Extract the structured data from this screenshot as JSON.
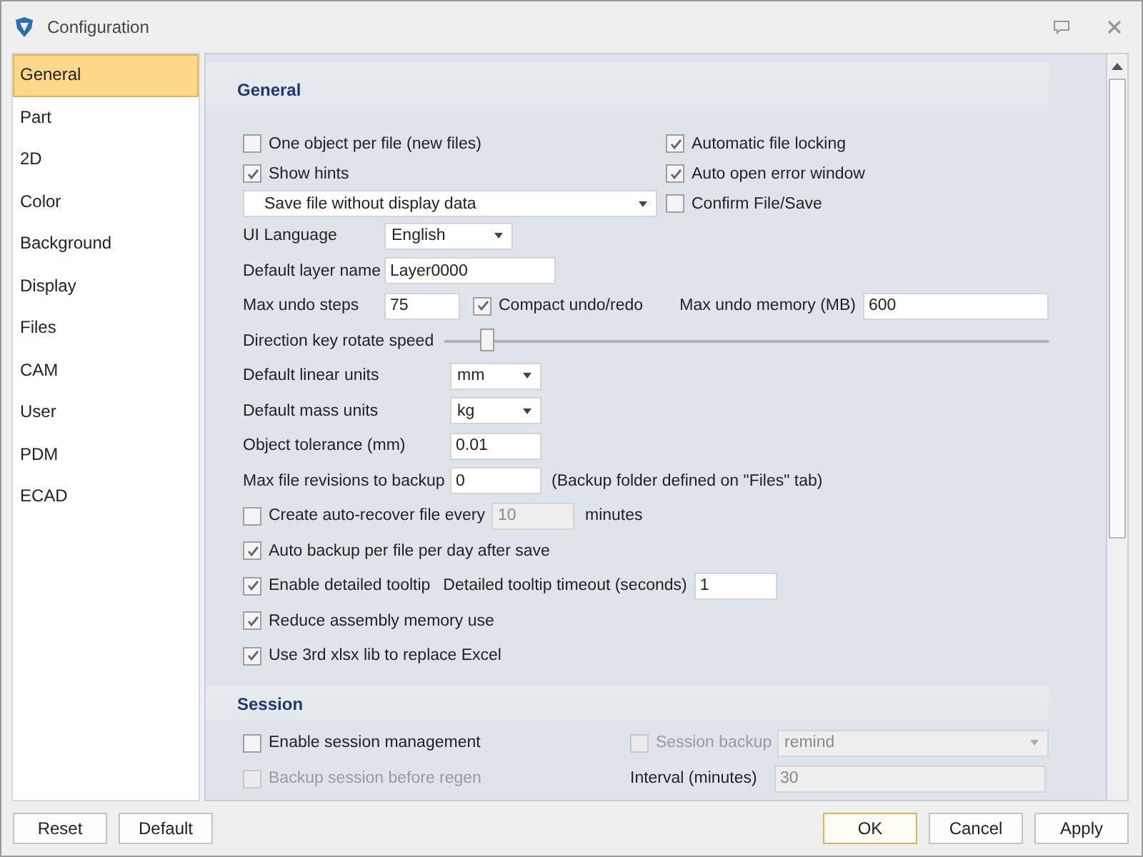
{
  "window": {
    "title": "Configuration"
  },
  "sidebar": {
    "items": [
      {
        "label": "General",
        "selected": true
      },
      {
        "label": "Part",
        "selected": false
      },
      {
        "label": "2D",
        "selected": false
      },
      {
        "label": "Color",
        "selected": false
      },
      {
        "label": "Background",
        "selected": false
      },
      {
        "label": "Display",
        "selected": false
      },
      {
        "label": "Files",
        "selected": false
      },
      {
        "label": "CAM",
        "selected": false
      },
      {
        "label": "User",
        "selected": false
      },
      {
        "label": "PDM",
        "selected": false
      },
      {
        "label": "ECAD",
        "selected": false
      }
    ]
  },
  "general": {
    "title": "General",
    "left_options": [
      {
        "kind": "checkbox",
        "label": "One object per file (new files)",
        "checked": false
      },
      {
        "kind": "checkbox",
        "label": "Show hints",
        "checked": true
      },
      {
        "kind": "select",
        "value": "Save file without display data"
      }
    ],
    "right_options": [
      {
        "label": "Automatic file locking",
        "checked": true
      },
      {
        "label": "Auto open error window",
        "checked": true
      },
      {
        "label": "Confirm File/Save",
        "checked": false
      }
    ],
    "rows": [
      {
        "kind": "select",
        "label": "UI Language",
        "value": "English"
      },
      {
        "kind": "input",
        "label": "Default layer name",
        "value": "Layer0000"
      },
      {
        "kind": "undo",
        "label": "Max undo steps",
        "value": "75",
        "option": {
          "label": "Compact undo/redo",
          "checked": true
        },
        "memory_label": "Max undo memory (MB)",
        "memory_value": "600"
      },
      {
        "kind": "slider",
        "label": "Direction key rotate speed",
        "level": 0.06
      }
    ],
    "unit_rows": [
      {
        "kind": "select",
        "label": "Default linear units",
        "value": "mm"
      },
      {
        "kind": "select",
        "label": "Default mass units",
        "value": "kg"
      },
      {
        "kind": "input",
        "label": "Object tolerance  (mm)",
        "value": "0.01"
      },
      {
        "kind": "input",
        "label": "Max file revisions to backup",
        "value": "0",
        "note": "(Backup folder defined on \"Files\" tab)"
      }
    ],
    "options": [
      {
        "label": "Create auto-recover file every",
        "checked": false,
        "value": "10",
        "field_disabled": true,
        "suffix": "minutes"
      },
      {
        "label": "Auto backup per file per day after save",
        "checked": true
      },
      {
        "label": "Enable detailed tooltip",
        "checked": true,
        "field_label": "Detailed tooltip timeout (seconds)",
        "value": "1",
        "field_disabled": false
      },
      {
        "label": "Reduce assembly memory use",
        "checked": true
      },
      {
        "label": "Use 3rd xlsx lib to replace Excel",
        "checked": true
      }
    ]
  },
  "session": {
    "title": "Session",
    "left": [
      {
        "label": "Enable session management",
        "checked": false,
        "disabled": false
      },
      {
        "label": "Backup session before regen",
        "checked": false,
        "disabled": true
      }
    ],
    "backup": {
      "label": "Session backup",
      "checked": false,
      "disabled": true,
      "value": "remind"
    },
    "interval": {
      "label": "Interval (minutes)",
      "value": "30"
    }
  },
  "buttons_left": [
    {
      "label": "Reset"
    },
    {
      "label": "Default"
    }
  ],
  "buttons_right": [
    {
      "label": "OK",
      "default": true
    },
    {
      "label": "Cancel",
      "default": false
    },
    {
      "label": "Apply",
      "default": false
    }
  ]
}
